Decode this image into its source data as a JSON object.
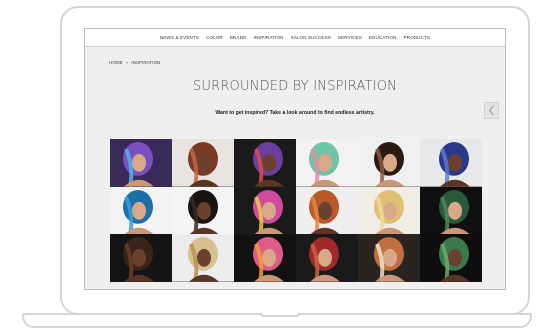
{
  "nav": {
    "items": [
      "NEWS & EVENTS",
      "COLOR",
      "BRAND",
      "INSPIRATION",
      "SALON SUCCESS",
      "SERVICES",
      "EDUCATION",
      "PRODUCTS"
    ]
  },
  "breadcrumb": {
    "home": "HOME",
    "separator": "»",
    "current": "INSPIRATION"
  },
  "page": {
    "title": "SURROUNDED BY INSPIRATION",
    "subtitle": "Want to get inspired? Take a look around to find endless artistry."
  },
  "carousel": {
    "prev_icon": "chevron-left-icon"
  },
  "gallery": {
    "tiles": [
      {
        "name": "purple-blue-hair-photo",
        "bg": "#3a2a5a",
        "hair": "#7a4fbf",
        "accent": "#4fb6e6"
      },
      {
        "name": "auburn-bob-photo",
        "bg": "#e8e4e0",
        "hair": "#7a3a24",
        "accent": "#c06a40"
      },
      {
        "name": "colorful-wrap-photo",
        "bg": "#1a1a1a",
        "hair": "#6a3fa0",
        "accent": "#e04a4a"
      },
      {
        "name": "rainbow-strands-photo",
        "bg": "#f2f2f2",
        "hair": "#6fc4a8",
        "accent": "#e88aa0"
      },
      {
        "name": "dark-crop-photo",
        "bg": "#f0f0f0",
        "hair": "#2a1a14",
        "accent": "#8a5a44"
      },
      {
        "name": "blue-updo-photo",
        "bg": "#e8e8e8",
        "hair": "#2a3a8a",
        "accent": "#5a7ad0"
      },
      {
        "name": "blue-profile-photo",
        "bg": "#f2f2f2",
        "hair": "#1e6fa8",
        "accent": "#3aa0d8"
      },
      {
        "name": "afro-puff-photo",
        "bg": "#f4f4f4",
        "hair": "#1a1410",
        "accent": "#3a2a22"
      },
      {
        "name": "neon-long-hair-photo",
        "bg": "#1a1a1a",
        "hair": "#d04aa0",
        "accent": "#e8d040"
      },
      {
        "name": "copper-braid-photo",
        "bg": "#efefef",
        "hair": "#b85a2a",
        "accent": "#e08a40"
      },
      {
        "name": "blonde-waves-photo",
        "bg": "#f0ece6",
        "hair": "#e0c070",
        "accent": "#f0d898"
      },
      {
        "name": "green-fringe-photo",
        "bg": "#101010",
        "hair": "#2a5a3a",
        "accent": "#4a8a5a"
      },
      {
        "name": "dark-bob-photo",
        "bg": "#141414",
        "hair": "#3a2418",
        "accent": "#6a4028"
      },
      {
        "name": "platinum-curls-photo",
        "bg": "#ececec",
        "hair": "#d8c090",
        "accent": "#b89050"
      },
      {
        "name": "multicolor-long-photo",
        "bg": "#121212",
        "hair": "#e05a8a",
        "accent": "#f0a030"
      },
      {
        "name": "red-afro-photo",
        "bg": "#1a1a1a",
        "hair": "#a02a2a",
        "accent": "#d06040"
      },
      {
        "name": "floral-curls-photo",
        "bg": "#2a2420",
        "hair": "#c07040",
        "accent": "#f0e0d0"
      },
      {
        "name": "green-streaks-photo",
        "bg": "#0e0e0e",
        "hair": "#3a7a4a",
        "accent": "#6aaa6a"
      }
    ]
  }
}
